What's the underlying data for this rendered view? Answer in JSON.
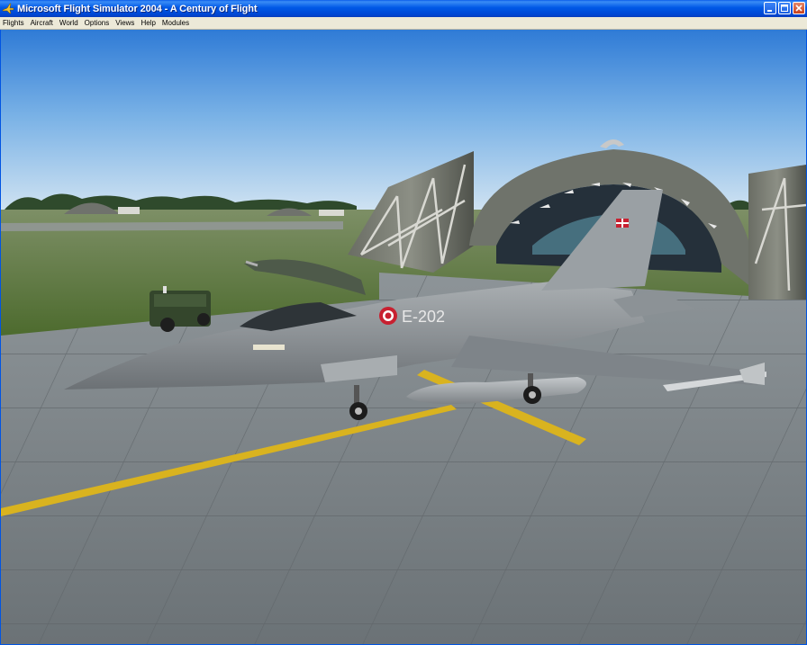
{
  "window": {
    "title": "Microsoft Flight Simulator 2004 - A Century of Flight",
    "icon": "fs-plane-icon"
  },
  "titlebar_buttons": [
    {
      "name": "minimize-button",
      "icon": "minimize-icon"
    },
    {
      "name": "maximize-button",
      "icon": "maximize-icon"
    },
    {
      "name": "close-button",
      "icon": "close-icon"
    }
  ],
  "menu": {
    "items": [
      "Flights",
      "Aircraft",
      "World",
      "Options",
      "Views",
      "Help",
      "Modules"
    ]
  },
  "scene": {
    "aircraft_code": "E-202"
  },
  "colors": {
    "title_blue": "#0058e6",
    "menu_bg": "#ece9d8",
    "sky_top": "#3d8ade",
    "sky_bottom": "#d8e8f2",
    "apron": "#767d82",
    "taxi_line": "#d8b01a",
    "grass": "#5e7a3c"
  }
}
